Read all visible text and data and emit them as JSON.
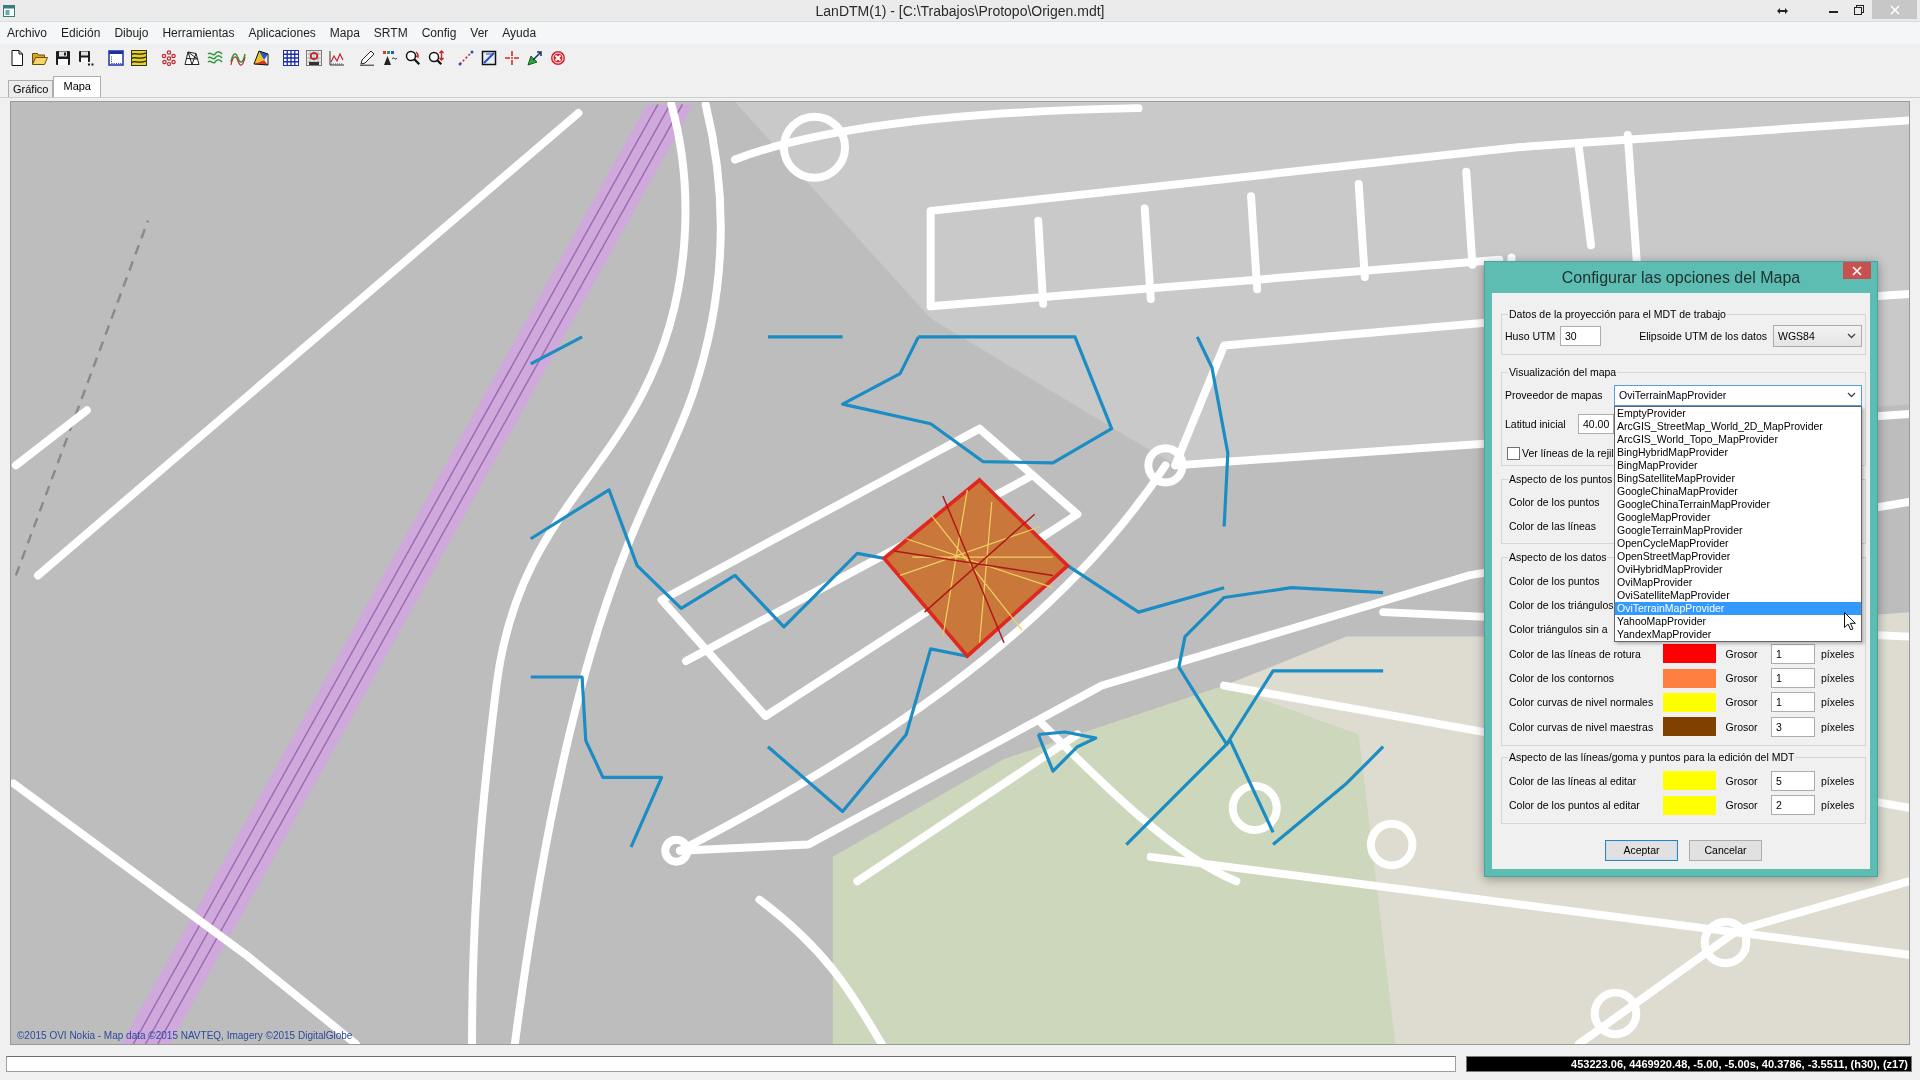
{
  "window": {
    "title": "LanDTM(1) - [C:\\Trabajos\\Protopo\\Origen.mdt]"
  },
  "menu": [
    "Archivo",
    "Edición",
    "Dibujo",
    "Herramientas",
    "Aplicaciones",
    "Mapa",
    "SRTM",
    "Config",
    "Ver",
    "Ayuda"
  ],
  "tabs": [
    {
      "label": "Gráfico",
      "selected": false
    },
    {
      "label": "Mapa",
      "selected": true
    }
  ],
  "map": {
    "copyright": "©2015 OVI Nokia - Map data ©2015 NAVTEQ, Imagery ©2015 DigitalGlobe"
  },
  "dialog": {
    "title": "Configurar las opciones del Mapa",
    "groups": [
      {
        "legend": "Datos de la proyección para el MDT de trabajo",
        "rows": [
          {
            "kind": "fields",
            "fields": [
              {
                "kind": "input",
                "label": "Huso UTM",
                "value": "30"
              },
              {
                "kind": "select",
                "label": "Elipsoide UTM de los datos",
                "value": "WGS84"
              }
            ]
          }
        ]
      },
      {
        "legend": "Visualización del mapa",
        "rows": [
          {
            "kind": "fields",
            "fields": [
              {
                "kind": "select",
                "label": "Proveedor de mapas",
                "value": "OviTerrainMapProvider",
                "expanded": true,
                "options": [
                  {
                    "label": "EmptyProvider",
                    "selected": false
                  },
                  {
                    "label": "ArcGIS_StreetMap_World_2D_MapProvider",
                    "selected": false
                  },
                  {
                    "label": "ArcGIS_World_Topo_MapProvider",
                    "selected": false
                  },
                  {
                    "label": "BingHybridMapProvider",
                    "selected": false
                  },
                  {
                    "label": "BingMapProvider",
                    "selected": false
                  },
                  {
                    "label": "BingSatelliteMapProvider",
                    "selected": false
                  },
                  {
                    "label": "GoogleChinaMapProvider",
                    "selected": false
                  },
                  {
                    "label": "GoogleChinaTerrainMapProvider",
                    "selected": false
                  },
                  {
                    "label": "GoogleMapProvider",
                    "selected": false
                  },
                  {
                    "label": "GoogleTerrainMapProvider",
                    "selected": false
                  },
                  {
                    "label": "OpenCycleMapProvider",
                    "selected": false
                  },
                  {
                    "label": "OpenStreetMapProvider",
                    "selected": false
                  },
                  {
                    "label": "OviHybridMapProvider",
                    "selected": false
                  },
                  {
                    "label": "OviMapProvider",
                    "selected": false
                  },
                  {
                    "label": "OviSatelliteMapProvider",
                    "selected": false
                  },
                  {
                    "label": "OviTerrainMapProvider",
                    "selected": true
                  },
                  {
                    "label": "YahooMapProvider",
                    "selected": false
                  },
                  {
                    "label": "YandexMapProvider",
                    "selected": false
                  }
                ]
              }
            ]
          },
          {
            "kind": "fields",
            "fields": [
              {
                "kind": "input",
                "label": "Latitud inicial",
                "value": "40.00"
              }
            ]
          },
          {
            "kind": "checkbox",
            "label": "Ver líneas de la rejil",
            "checked": false
          }
        ]
      },
      {
        "legend": "Aspecto de los puntos",
        "rows": [
          {
            "kind": "color",
            "label": "Color de los puntos"
          },
          {
            "kind": "color",
            "label": "Color de las líneas"
          }
        ]
      },
      {
        "legend": "Aspecto de los datos",
        "rows": [
          {
            "kind": "color",
            "label": "Color de los puntos"
          },
          {
            "kind": "color",
            "label": "Color de los triángulos"
          },
          {
            "kind": "color",
            "label": "Color triángulos sin a"
          },
          {
            "kind": "color",
            "label": "Color de las líneas de rotura",
            "color": "#ff0000",
            "thickness_label": "Grosor",
            "thickness": "1",
            "unit": "píxeles"
          },
          {
            "kind": "color",
            "label": "Color de los contornos",
            "color": "#ff7f40",
            "thickness_label": "Grosor",
            "thickness": "1",
            "unit": "píxeles"
          },
          {
            "kind": "color",
            "label": "Color curvas de nivel normales",
            "color": "#ffff00",
            "thickness_label": "Grosor",
            "thickness": "1",
            "unit": "píxeles"
          },
          {
            "kind": "color",
            "label": "Color curvas de nivel maestras",
            "color": "#804000",
            "thickness_label": "Grosor",
            "thickness": "3",
            "unit": "píxeles"
          }
        ]
      },
      {
        "legend": "Aspecto de las líneas/goma y puntos para la edición del MDT",
        "rows": [
          {
            "kind": "color",
            "label": "Color de las líneas al editar",
            "color": "#ffff00",
            "thickness_label": "Grosor",
            "thickness": "5",
            "unit": "píxeles"
          },
          {
            "kind": "color",
            "label": "Color de los puntos al editar",
            "color": "#ffff00",
            "thickness_label": "Grosor",
            "thickness": "2",
            "unit": "píxeles"
          }
        ]
      }
    ],
    "buttons": [
      {
        "label": "Aceptar",
        "default": true
      },
      {
        "label": "Cancelar",
        "default": false
      }
    ]
  },
  "status_bar": {
    "coordinates": "453223.06, 4469920.48, -5.00, -5.00s, 40.3786, -3.5511, (h30), (z17)"
  }
}
